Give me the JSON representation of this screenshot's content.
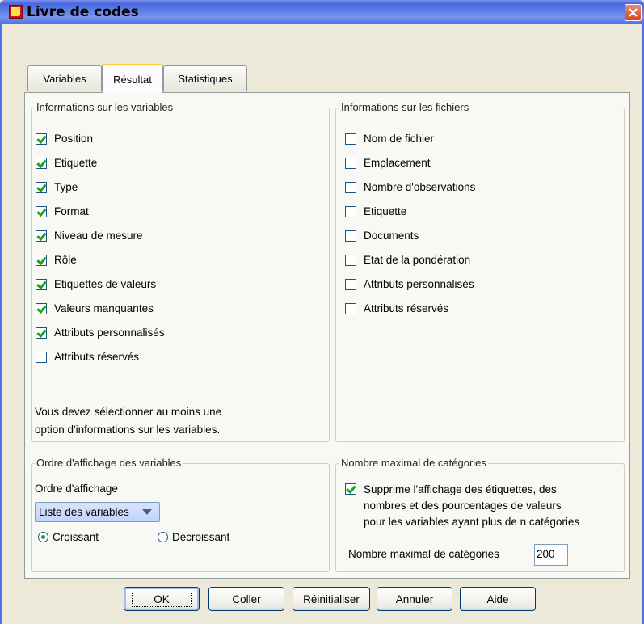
{
  "window": {
    "title": "Livre de codes",
    "icon": "table-grid-icon"
  },
  "tabs": [
    {
      "label": "Variables",
      "active": false
    },
    {
      "label": "Résultat",
      "active": true
    },
    {
      "label": "Statistiques",
      "active": false
    }
  ],
  "var_info": {
    "legend": "Informations sur les variables",
    "items": [
      {
        "label": "Position",
        "checked": true
      },
      {
        "label": "Etiquette",
        "checked": true
      },
      {
        "label": "Type",
        "checked": true
      },
      {
        "label": "Format",
        "checked": true
      },
      {
        "label": "Niveau de mesure",
        "checked": true
      },
      {
        "label": "Rôle",
        "checked": true
      },
      {
        "label": "Etiquettes de valeurs",
        "checked": true
      },
      {
        "label": "Valeurs manquantes",
        "checked": true
      },
      {
        "label": "Attributs personnalisés",
        "checked": true
      },
      {
        "label": "Attributs réservés",
        "checked": false
      }
    ],
    "note_line1": "Vous devez sélectionner au moins une",
    "note_line2": "option d'informations sur les variables."
  },
  "file_info": {
    "legend": "Informations sur les fichiers",
    "items": [
      {
        "label": "Nom de fichier",
        "checked": false
      },
      {
        "label": "Emplacement",
        "checked": false
      },
      {
        "label": "Nombre d'observations",
        "checked": false
      },
      {
        "label": "Etiquette",
        "checked": false
      },
      {
        "label": "Documents",
        "checked": false
      },
      {
        "label": "Etat de la pondération",
        "checked": false
      },
      {
        "label": "Attributs personnalisés",
        "checked": false
      },
      {
        "label": "Attributs réservés",
        "checked": false
      }
    ]
  },
  "order": {
    "legend": "Ordre d'affichage des variables",
    "label": "Ordre d'affichage",
    "selected": "Liste des variables",
    "radio_asc": "Croissant",
    "radio_desc": "Décroissant",
    "ascending": true
  },
  "max_cat": {
    "legend": "Nombre maximal de catégories",
    "suppress_line1": "Supprime l'affichage des étiquettes, des",
    "suppress_line2": "nombres et des pourcentages de valeurs",
    "suppress_line3": "pour les variables ayant plus de n catégories",
    "suppress_checked": true,
    "count_label": "Nombre maximal de catégories",
    "count_value": "200"
  },
  "buttons": {
    "ok": "OK",
    "paste": "Coller",
    "reset": "Réinitialiser",
    "cancel": "Annuler",
    "help": "Aide"
  }
}
